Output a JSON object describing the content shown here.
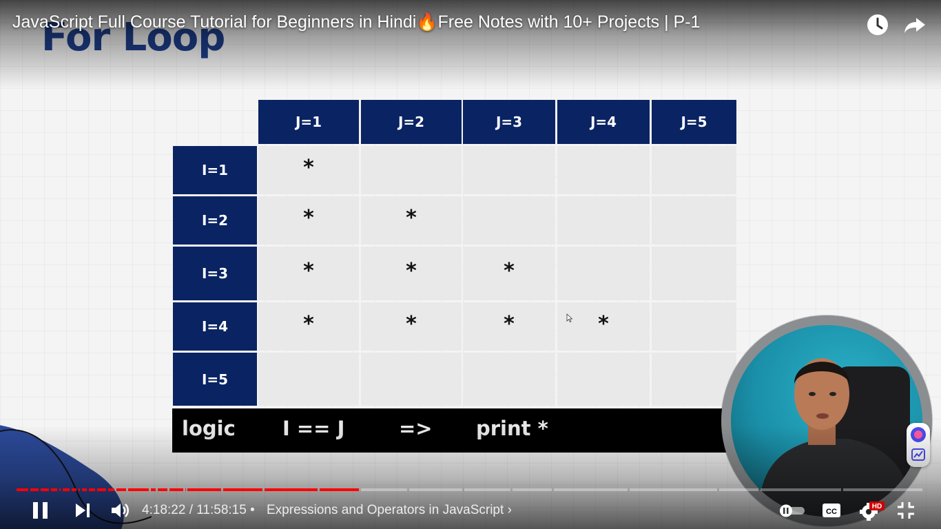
{
  "slide": {
    "title": "For Loop",
    "col_headers": [
      "J=1",
      "J=2",
      "J=3",
      "J=4",
      "J=5"
    ],
    "row_headers": [
      "I=1",
      "I=2",
      "I=3",
      "I=4",
      "I=5"
    ],
    "mark": "*",
    "marks": [
      [
        1,
        0,
        0,
        0,
        0
      ],
      [
        1,
        1,
        0,
        0,
        0
      ],
      [
        1,
        1,
        1,
        0,
        0
      ],
      [
        1,
        1,
        1,
        1,
        0
      ],
      [
        0,
        0,
        0,
        0,
        0
      ]
    ],
    "logic": {
      "word": "logic",
      "condition": "I == J",
      "arrow": "=>",
      "action": "print *"
    }
  },
  "player": {
    "video_title": "JavaScript Full Course Tutorial for Beginners in Hindi🔥Free Notes with 10+ Projects | P-1",
    "current_time": "4:18:22",
    "separator": "/",
    "duration": "11:58:15",
    "bullet": "•",
    "chapter": "Expressions and Operators in JavaScript",
    "chapter_chevron": "›",
    "played_fraction": 0.36,
    "hd_badge": "HD",
    "cc_label": "CC",
    "colors": {
      "progress_played": "#ff0000",
      "progress_unplayed": "rgba(255,255,255,0.35)",
      "header_navy": "#0a2363",
      "hd_badge": "#cc0000"
    },
    "icons": [
      "watch-later-icon",
      "share-icon",
      "pause-icon",
      "next-icon",
      "volume-icon",
      "autoplay-toggle-icon",
      "captions-icon",
      "settings-icon",
      "exit-fullscreen-icon"
    ]
  }
}
